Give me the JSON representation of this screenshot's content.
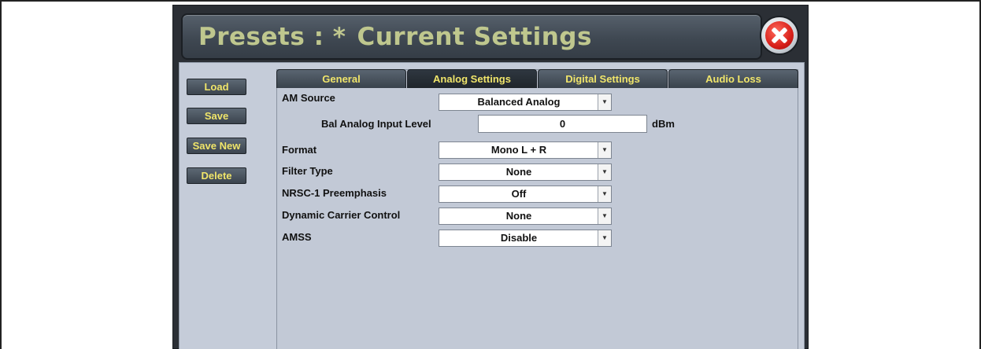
{
  "window": {
    "title_prefix": "Presets : *",
    "title_name": "Current Settings"
  },
  "sidebar": {
    "load": "Load",
    "save": "Save",
    "save_new": "Save New",
    "delete": "Delete"
  },
  "tabs": [
    "General",
    "Analog Settings",
    "Digital Settings",
    "Audio Loss"
  ],
  "active_tab": "Analog Settings",
  "form": {
    "am_source": {
      "label": "AM Source",
      "value": "Balanced Analog"
    },
    "bal_analog_input_level": {
      "label": "Bal Analog Input Level",
      "value": "0",
      "unit": "dBm"
    },
    "format": {
      "label": "Format",
      "value": "Mono L + R"
    },
    "filter_type": {
      "label": "Filter Type",
      "value": "None"
    },
    "nrsc1_preemphasis": {
      "label": "NRSC-1 Preemphasis",
      "value": "Off"
    },
    "dynamic_carrier_control": {
      "label": "Dynamic Carrier Control",
      "value": "None"
    },
    "amss": {
      "label": "AMSS",
      "value": "Disable"
    }
  },
  "icons": {
    "dropdown": "chevron-down-icon",
    "close": "close-icon"
  },
  "colors": {
    "title_text": "#bfc78e",
    "button_text": "#f0e56a",
    "panel_bg": "#c5ccd9",
    "close_red": "#d8201a"
  }
}
